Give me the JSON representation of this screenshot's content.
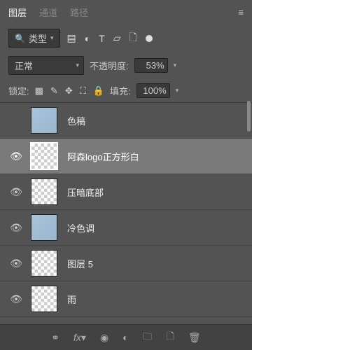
{
  "tabs": {
    "layers": "图层",
    "channels": "通道",
    "paths": "路径"
  },
  "filter": {
    "type_label": "类型"
  },
  "blend": {
    "mode": "正常",
    "opacity_label": "不透明度:",
    "opacity_value": "53%"
  },
  "lock": {
    "label": "锁定:",
    "fill_label": "填充:",
    "fill_value": "100%"
  },
  "layers": [
    {
      "visible": false,
      "name": "色稿",
      "thumb": "solid"
    },
    {
      "visible": true,
      "name": "阿森logo正方形白",
      "selected": true,
      "thumb": "checker"
    },
    {
      "visible": true,
      "name": "压暗底部",
      "thumb": "checker"
    },
    {
      "visible": true,
      "name": "冷色调",
      "thumb": "solid"
    },
    {
      "visible": true,
      "name": "图层 5",
      "thumb": "checker"
    },
    {
      "visible": true,
      "name": "雨",
      "thumb": "checker"
    }
  ]
}
